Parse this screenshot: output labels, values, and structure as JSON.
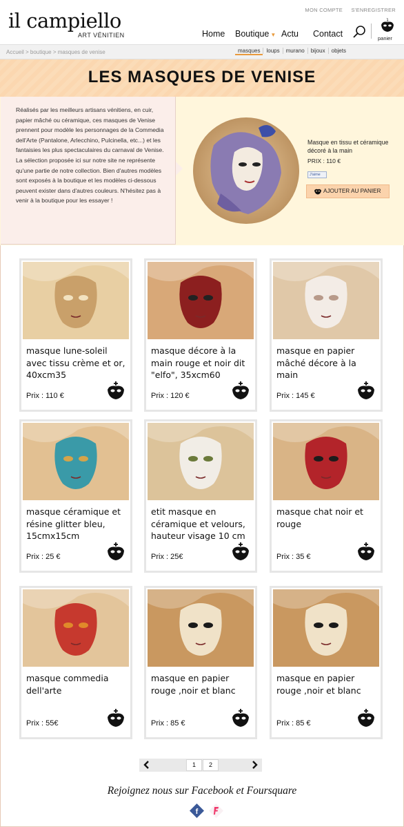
{
  "header": {
    "logo": "il campiello",
    "logo_sub": "ART VÉNITIEN",
    "top_links": [
      "MON COMPTE",
      "S'ENREGISTRER"
    ],
    "nav": [
      "Home",
      "Boutique",
      "Actu",
      "Contact"
    ],
    "cart_label": "panier",
    "cart_count": "1"
  },
  "breadcrumb": "Accueil > boutique > masques de venise",
  "subnav": [
    "masques",
    "loups",
    "murano",
    "bijoux",
    "objets"
  ],
  "page_title": "LES MASQUES DE VENISE",
  "intro": {
    "text": "Réalisés par les meilleurs artisans vénitiens, en cuir, papier mâché ou céramique, ces masques de Venise prennent pour modèle les personnages de la Commedia dell'Arte (Pantalone, Arlecchino, Pulcinella, etc...) et les fantaisies les plus spectaculaires du carnaval de Venise. La sélection proposée ici sur notre site ne représente qu'une partie de notre collection. Bien d'autres modèles sont exposés à la boutique et les modèles ci-dessous peuvent exister dans d'autres couleurs. N'hésitez pas à venir à la boutique pour les essayer !"
  },
  "featured": {
    "title": "Masque en tissu et céramique décoré à la main",
    "price": "PRIX : 110 €",
    "like": "J'aime",
    "add_to_cart": "AJOUTER AU PANIER"
  },
  "products": [
    {
      "title": "masque lune-soleil avec tissu crème et or, 40xcm35",
      "price": "Prix : 110 €"
    },
    {
      "title": "masque décore à la main rouge et noir dit \"elfo\", 35xcm60",
      "price": "Prix : 120 €"
    },
    {
      "title": "masque en papier mâché décore à la main",
      "price": "Prix : 145 €"
    },
    {
      "title": "masque céramique et résine glitter bleu, 15cmx15cm",
      "price": "Prix : 25 €"
    },
    {
      "title": "etit masque en céramique et velours, hauteur visage 10 cm",
      "price": "Prix : 25€"
    },
    {
      "title": "masque chat noir et rouge",
      "price": "Prix : 35 €"
    },
    {
      "title": "masque commedia dell'arte",
      "price": "Prix : 55€"
    },
    {
      "title": "masque en papier rouge ,noir et blanc",
      "price": "Prix : 85 €"
    },
    {
      "title": "masque en papier rouge ,noir et blanc",
      "price": "Prix : 85 €"
    }
  ],
  "pagination": {
    "pages": [
      "1",
      "2"
    ]
  },
  "footer": {
    "text": "Rejoignez nous sur Facebook et Foursquare"
  },
  "colors": {
    "accent": "#e89a3c",
    "banner": "#fbd7b0",
    "intro_bg": "#fff6dc",
    "cart_button": "#fbd3ac"
  },
  "icons": [
    "search-icon",
    "cart-mask-icon",
    "chevron-left-icon",
    "chevron-right-icon",
    "facebook-icon",
    "foursquare-icon"
  ]
}
